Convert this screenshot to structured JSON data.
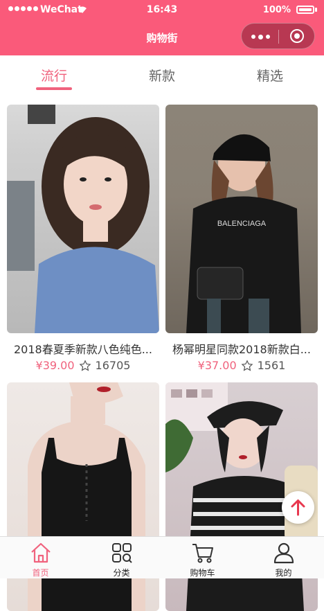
{
  "status_bar": {
    "carrier": "WeChat",
    "time": "16:43",
    "battery": "100%"
  },
  "nav": {
    "title": "购物街"
  },
  "tabs": [
    {
      "label": "流行",
      "active": true
    },
    {
      "label": "新款",
      "active": false
    },
    {
      "label": "精选",
      "active": false
    }
  ],
  "products": [
    {
      "title": "2018春夏季新款八色纯色...",
      "price": "¥39.00",
      "favorites": "16705"
    },
    {
      "title": "杨幂明星同款2018新款白...",
      "price": "¥37.00",
      "favorites": "1561"
    },
    {
      "title": "",
      "price": "",
      "favorites": ""
    },
    {
      "title": "",
      "price": "",
      "favorites": ""
    }
  ],
  "tabbar": [
    {
      "label": "首页",
      "icon": "home-icon",
      "active": true
    },
    {
      "label": "分类",
      "icon": "category-icon",
      "active": false
    },
    {
      "label": "购物车",
      "icon": "cart-icon",
      "active": false
    },
    {
      "label": "我的",
      "icon": "profile-icon",
      "active": false
    }
  ],
  "colors": {
    "brand": "#fa5a7a",
    "accent": "#f0627d"
  }
}
